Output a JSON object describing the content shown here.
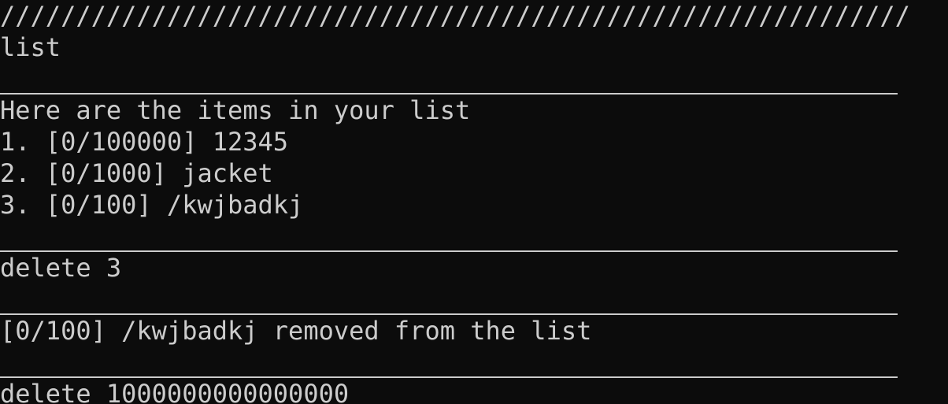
{
  "terminal": {
    "top_border": "////////////////////////////////////////////////////////////",
    "lines": {
      "cmd_list": "list",
      "list_header": "Here are the items in your list",
      "item_1": "1. [0/100000] 12345",
      "item_2": "2. [0/1000] jacket",
      "item_3": "3. [0/100] /kwjbadkj",
      "cmd_delete_3": "delete 3",
      "removed_msg": "[0/100] /kwjbadkj removed from the list",
      "cmd_delete_big": "delete 1000000000000000"
    }
  },
  "colors": {
    "background": "#0c0c0c",
    "foreground": "#cccccc"
  }
}
